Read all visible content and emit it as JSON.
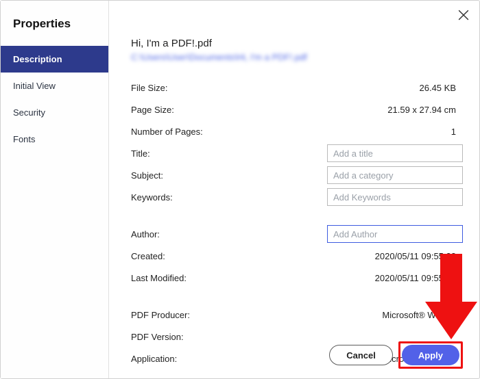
{
  "sidebar": {
    "title": "Properties",
    "tabs": [
      "Description",
      "Initial View",
      "Security",
      "Fonts"
    ]
  },
  "header": {
    "filename": "Hi, I'm a PDF!.pdf",
    "filepath": "C:\\Users\\User\\Documents\\Hi, I'm a PDF!.pdf"
  },
  "fields": {
    "file_size": {
      "label": "File Size:",
      "value": "26.45 KB"
    },
    "page_size": {
      "label": "Page Size:",
      "value": "21.59 x 27.94 cm"
    },
    "num_pages": {
      "label": "Number of Pages:",
      "value": "1"
    },
    "title": {
      "label": "Title:",
      "placeholder": "Add a title"
    },
    "subject": {
      "label": "Subject:",
      "placeholder": "Add a category"
    },
    "keywords": {
      "label": "Keywords:",
      "placeholder": "Add Keywords"
    },
    "author": {
      "label": "Author:",
      "placeholder": "Add Author"
    },
    "created": {
      "label": "Created:",
      "value": "2020/05/11 09:55:22"
    },
    "modified": {
      "label": "Last Modified:",
      "value": "2020/05/11 09:55:22"
    },
    "producer": {
      "label": "PDF Producer:",
      "value": "Microsoft® Word 2"
    },
    "version": {
      "label": "PDF Version:",
      "value": ""
    },
    "application": {
      "label": "Application:",
      "value": "Microsoft® Word 2"
    }
  },
  "buttons": {
    "cancel": "Cancel",
    "apply": "Apply"
  }
}
